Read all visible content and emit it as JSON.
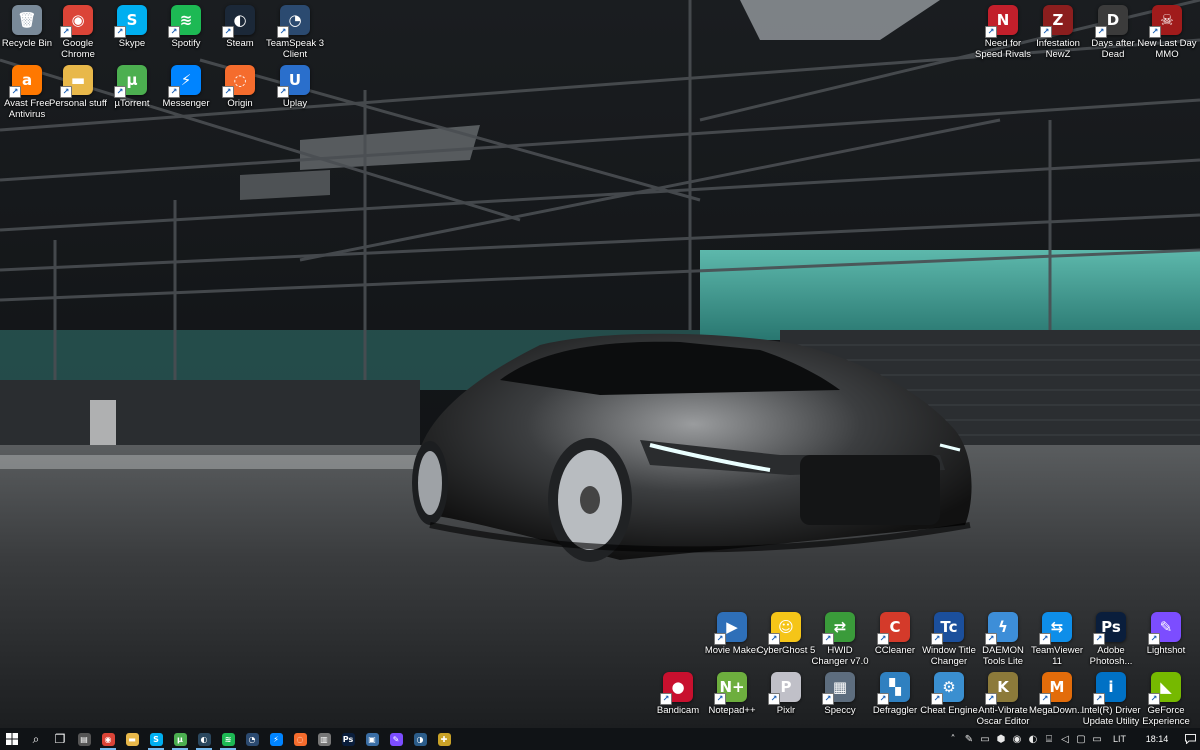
{
  "desktop": {
    "left_icons": [
      {
        "label": "Recycle Bin",
        "icon": "recycle-bin-icon",
        "glyph": "🗑",
        "color": "#7a8a99"
      },
      {
        "label": "Google Chrome",
        "icon": "chrome-icon",
        "glyph": "◉",
        "color": "#db4437"
      },
      {
        "label": "Skype",
        "icon": "skype-icon",
        "glyph": "S",
        "color": "#00aff0"
      },
      {
        "label": "Spotify",
        "icon": "spotify-icon",
        "glyph": "≋",
        "color": "#1db954"
      },
      {
        "label": "Steam",
        "icon": "steam-icon",
        "glyph": "◐",
        "color": "#1b2838"
      },
      {
        "label": "TeamSpeak 3 Client",
        "icon": "teamspeak-icon",
        "glyph": "◔",
        "color": "#2b4a70"
      },
      {
        "label": "Avast Free Antivirus",
        "icon": "avast-icon",
        "glyph": "a",
        "color": "#ff7800"
      },
      {
        "label": "Personal stuff",
        "icon": "folder-icon",
        "glyph": "▬",
        "color": "#e8b84a"
      },
      {
        "label": "µTorrent",
        "icon": "utorrent-icon",
        "glyph": "µ",
        "color": "#4caf50"
      },
      {
        "label": "Messenger",
        "icon": "messenger-icon",
        "glyph": "⚡",
        "color": "#0084ff"
      },
      {
        "label": "Origin",
        "icon": "origin-icon",
        "glyph": "◌",
        "color": "#f56c2d"
      },
      {
        "label": "Uplay",
        "icon": "uplay-icon",
        "glyph": "U",
        "color": "#2a6fcc"
      }
    ],
    "right_top_icons": [
      {
        "label": "Need for Speed Rivals",
        "icon": "nfs-rivals-icon",
        "glyph": "N",
        "color": "#c21f2b"
      },
      {
        "label": "Infestation NewZ",
        "icon": "infestation-icon",
        "glyph": "Z",
        "color": "#8b1e1e"
      },
      {
        "label": "Days after Dead",
        "icon": "days-after-dead-icon",
        "glyph": "D",
        "color": "#3b3b3b"
      },
      {
        "label": "New Last Day MMO",
        "icon": "last-day-icon",
        "glyph": "☠",
        "color": "#a01b1b"
      }
    ],
    "bottom_row1": [
      {
        "label": "Movie Maker",
        "icon": "movie-maker-icon",
        "glyph": "▶",
        "color": "#2e6fb8"
      },
      {
        "label": "CyberGhost 5",
        "icon": "cyberghost-icon",
        "glyph": "☺",
        "color": "#f5c518"
      },
      {
        "label": "HWID Changer v7.0",
        "icon": "hwid-changer-icon",
        "glyph": "⇄",
        "color": "#3a9b3a"
      },
      {
        "label": "CCleaner",
        "icon": "ccleaner-icon",
        "glyph": "C",
        "color": "#d43a2a"
      },
      {
        "label": "Window Title Changer",
        "icon": "window-title-changer-icon",
        "glyph": "Tc",
        "color": "#1b4f9c"
      },
      {
        "label": "DAEMON Tools Lite",
        "icon": "daemon-tools-icon",
        "glyph": "ϟ",
        "color": "#3d8ed8"
      },
      {
        "label": "TeamViewer 11",
        "icon": "teamviewer-icon",
        "glyph": "⇆",
        "color": "#0e8ee9"
      },
      {
        "label": "Adobe Photosh...",
        "icon": "photoshop-icon",
        "glyph": "Ps",
        "color": "#0a1e3c"
      },
      {
        "label": "Lightshot",
        "icon": "lightshot-icon",
        "glyph": "✎",
        "color": "#7c4dff"
      }
    ],
    "bottom_row2": [
      {
        "label": "Bandicam",
        "icon": "bandicam-icon",
        "glyph": "●",
        "color": "#c8102e"
      },
      {
        "label": "Notepad++",
        "icon": "notepadpp-icon",
        "glyph": "N+",
        "color": "#6dae3e"
      },
      {
        "label": "Pixlr",
        "icon": "pixlr-icon",
        "glyph": "P",
        "color": "#c0c0c8"
      },
      {
        "label": "Speccy",
        "icon": "speccy-icon",
        "glyph": "▦",
        "color": "#5d6d7e"
      },
      {
        "label": "Defraggler",
        "icon": "defraggler-icon",
        "glyph": "▚",
        "color": "#2f80c0"
      },
      {
        "label": "Cheat Engine",
        "icon": "cheat-engine-icon",
        "glyph": "⚙",
        "color": "#3a8fd0"
      },
      {
        "label": "Anti-Vibrate Oscar Editor",
        "icon": "oscar-editor-icon",
        "glyph": "K",
        "color": "#8c7a3a"
      },
      {
        "label": "MegaDown...",
        "icon": "megadownloader-icon",
        "glyph": "M",
        "color": "#e36c0a"
      },
      {
        "label": "Intel(R) Driver Update Utility",
        "icon": "intel-driver-icon",
        "glyph": "i",
        "color": "#0071c5"
      },
      {
        "label": "GeForce Experience",
        "icon": "geforce-icon",
        "glyph": "◣",
        "color": "#76b900"
      }
    ]
  },
  "taskbar": {
    "start_icon": "windows-start-icon",
    "pinned": [
      {
        "name": "search",
        "icon": "search-icon",
        "glyph": "⌕",
        "color": "transparent",
        "running": false
      },
      {
        "name": "task-view",
        "icon": "task-view-icon",
        "glyph": "❐",
        "color": "transparent",
        "running": false
      },
      {
        "name": "calculator",
        "icon": "calculator-icon",
        "glyph": "▤",
        "color": "#555",
        "running": false
      },
      {
        "name": "chrome",
        "icon": "chrome-icon",
        "glyph": "◉",
        "color": "#db4437",
        "running": true
      },
      {
        "name": "file-explorer",
        "icon": "file-explorer-icon",
        "glyph": "▬",
        "color": "#e8b84a",
        "running": false
      },
      {
        "name": "skype",
        "icon": "skype-icon",
        "glyph": "S",
        "color": "#00aff0",
        "running": true
      },
      {
        "name": "utorrent",
        "icon": "utorrent-icon",
        "glyph": "µ",
        "color": "#4caf50",
        "running": true
      },
      {
        "name": "steam",
        "icon": "steam-icon",
        "glyph": "◐",
        "color": "#2a475e",
        "running": true
      },
      {
        "name": "spotify",
        "icon": "spotify-icon",
        "glyph": "≋",
        "color": "#1db954",
        "running": true
      },
      {
        "name": "teamspeak",
        "icon": "teamspeak-icon",
        "glyph": "◔",
        "color": "#2b4a70",
        "running": false
      },
      {
        "name": "messenger",
        "icon": "messenger-icon",
        "glyph": "⚡",
        "color": "#0084ff",
        "running": false
      },
      {
        "name": "origin",
        "icon": "origin-icon",
        "glyph": "◌",
        "color": "#f56c2d",
        "running": false
      },
      {
        "name": "network-tool",
        "icon": "network-tool-icon",
        "glyph": "▥",
        "color": "#777",
        "running": false
      },
      {
        "name": "photoshop",
        "icon": "photoshop-icon",
        "glyph": "Ps",
        "color": "#0a1e3c",
        "running": false
      },
      {
        "name": "monitor-tool",
        "icon": "monitor-tool-icon",
        "glyph": "▣",
        "color": "#3a6ea5",
        "running": false
      },
      {
        "name": "lightshot",
        "icon": "lightshot-icon",
        "glyph": "✎",
        "color": "#7c4dff",
        "running": false
      },
      {
        "name": "media",
        "icon": "media-icon",
        "glyph": "◑",
        "color": "#2c5d8a",
        "running": false
      },
      {
        "name": "puzzle-app",
        "icon": "puzzle-app-icon",
        "glyph": "✚",
        "color": "#c9a227",
        "running": false
      }
    ],
    "tray": [
      {
        "icon": "chevron-up-icon",
        "glyph": "˄"
      },
      {
        "icon": "lightshot-tray-icon",
        "glyph": "✎"
      },
      {
        "icon": "battery-tray-icon",
        "glyph": "▭"
      },
      {
        "icon": "red-shield-tray-icon",
        "glyph": "⬢"
      },
      {
        "icon": "cyan-app-tray-icon",
        "glyph": "◉"
      },
      {
        "icon": "steam-tray-icon",
        "glyph": "◐"
      },
      {
        "icon": "network-icon",
        "glyph": "⌸"
      },
      {
        "icon": "volume-icon",
        "glyph": "◁"
      },
      {
        "icon": "clipboard-tray-icon",
        "glyph": "▢"
      },
      {
        "icon": "message-tray-icon",
        "glyph": "▭"
      }
    ],
    "language": "LIT",
    "clock": "18:14",
    "notification_icon": "notification-icon"
  }
}
